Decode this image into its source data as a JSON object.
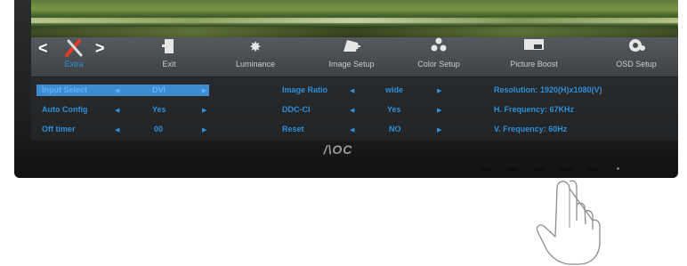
{
  "brand": "/\\OC",
  "menu": {
    "items": [
      {
        "label": "Extra",
        "icon": "tools-icon",
        "active": true
      },
      {
        "label": "Exit",
        "icon": "exit-door-icon"
      },
      {
        "label": "Luminance",
        "icon": "sun-icon"
      },
      {
        "label": "Image Setup",
        "icon": "image-setup-icon"
      },
      {
        "label": "Color Setup",
        "icon": "color-dots-icon"
      },
      {
        "label": "Picture Boost",
        "icon": "picture-boost-icon"
      },
      {
        "label": "OSD Setup",
        "icon": "osd-setup-icon"
      }
    ],
    "prev_symbol": "<",
    "next_symbol": ">"
  },
  "settings_left": [
    {
      "label": "Input Select",
      "value": "DVI",
      "selected": true
    },
    {
      "label": "Auto Config",
      "value": "Yes"
    },
    {
      "label": "Off timer",
      "value": "00"
    }
  ],
  "settings_middle": [
    {
      "label": "Image Ratio",
      "value": "wide"
    },
    {
      "label": "DDC-CI",
      "value": "Yes"
    },
    {
      "label": "Reset",
      "value": "NO"
    }
  ],
  "info": {
    "resolution": "Resolution:  1920(H)x1080(V)",
    "h_frequency": "H. Frequency:  67KHz",
    "v_frequency": "V. Frequency:  60Hz"
  },
  "colors": {
    "accent": "#2e8fd9",
    "osd_bg": "#252729",
    "menubar": "#4a4f52"
  }
}
